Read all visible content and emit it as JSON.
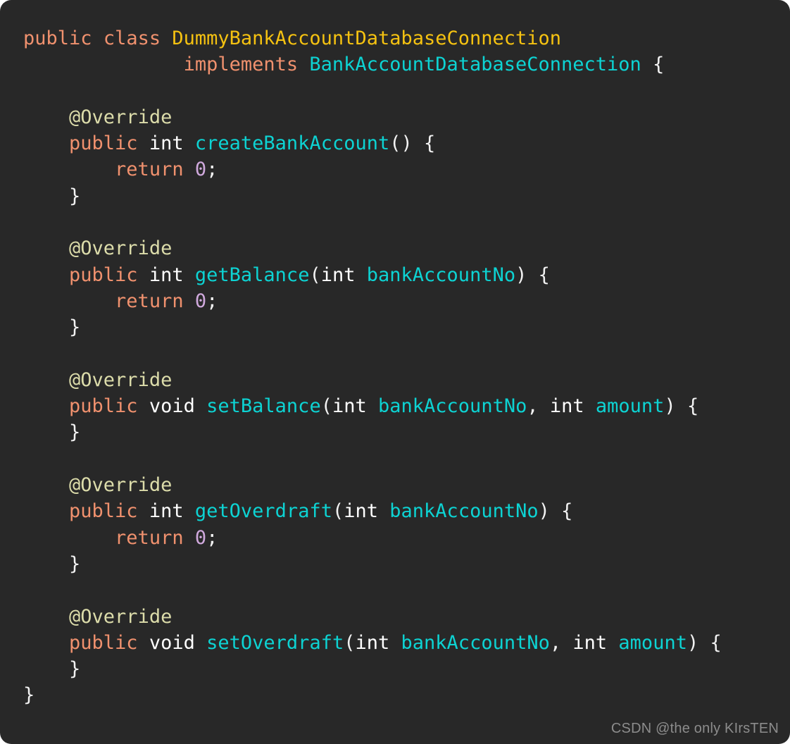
{
  "editor": {
    "language": "Java",
    "background_color": "#282828",
    "corner_radius_px": 16,
    "font_size_px": 27,
    "line_height_px": 37.3,
    "colors": {
      "keyword": "#f0916e",
      "primitive_type": "#ffffff",
      "class_name": "#f5c211",
      "interface_and_identifier": "#0dd3d3",
      "annotation": "#dcdcaa",
      "number_literal": "#d0a9dd",
      "punctuation": "#f2f2f2",
      "watermark": "#8c8c8c"
    }
  },
  "code": {
    "class_declaration": {
      "modifier": "public",
      "keyword": "class",
      "name": "DummyBankAccountDatabaseConnection",
      "implements_keyword": "implements",
      "interface": "BankAccountDatabaseConnection",
      "open_brace": "{",
      "close_brace": "}"
    },
    "annotation": "@Override",
    "methods": [
      {
        "modifier": "public",
        "return_type": "int",
        "name": "createBankAccount",
        "params": [],
        "body": "return 0;"
      },
      {
        "modifier": "public",
        "return_type": "int",
        "name": "getBalance",
        "params": [
          {
            "type": "int",
            "name": "bankAccountNo"
          }
        ],
        "body": "return 0;"
      },
      {
        "modifier": "public",
        "return_type": "void",
        "name": "setBalance",
        "params": [
          {
            "type": "int",
            "name": "bankAccountNo"
          },
          {
            "type": "int",
            "name": "amount"
          }
        ],
        "body": ""
      },
      {
        "modifier": "public",
        "return_type": "int",
        "name": "getOverdraft",
        "params": [
          {
            "type": "int",
            "name": "bankAccountNo"
          }
        ],
        "body": "return 0;"
      },
      {
        "modifier": "public",
        "return_type": "void",
        "name": "setOverdraft",
        "params": [
          {
            "type": "int",
            "name": "bankAccountNo"
          },
          {
            "type": "int",
            "name": "amount"
          }
        ],
        "body": ""
      }
    ],
    "tokens": {
      "kw_public": "public",
      "kw_class": "class",
      "kw_implements": "implements",
      "kw_return": "return",
      "type_int": "int",
      "type_void": "void",
      "annotation": "@Override",
      "zero": "0",
      "semicolon": ";",
      "comma": ",",
      "paren_open": "(",
      "paren_close": ")",
      "paren_empty": "()",
      "brace_open": "{",
      "brace_close": "}",
      "space": " ",
      "indent4": "    ",
      "indent8": "        ",
      "indent_implements": "              ",
      "class_name": "DummyBankAccountDatabaseConnection",
      "interface_name": "BankAccountDatabaseConnection",
      "m_createBankAccount": "createBankAccount",
      "m_getBalance": "getBalance",
      "m_setBalance": "setBalance",
      "m_getOverdraft": "getOverdraft",
      "m_setOverdraft": "setOverdraft",
      "p_bankAccountNo": "bankAccountNo",
      "p_amount": "amount",
      "comma_space": ", ",
      "paren_close_space_brace": ") {",
      "paren_empty_space_brace": "() {"
    }
  },
  "watermark": {
    "text": "CSDN @the only KIrsTEN"
  }
}
